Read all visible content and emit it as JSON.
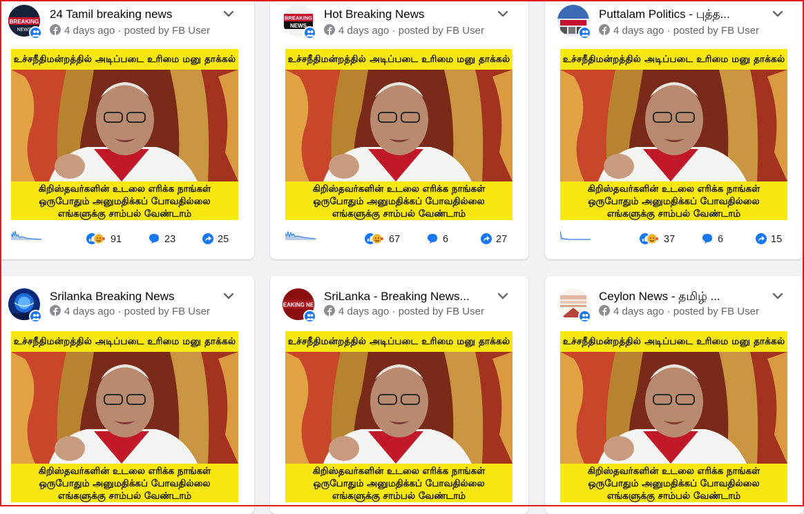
{
  "posts": [
    {
      "page_name": "24 Tamil breaking news",
      "time": "4 days ago",
      "posted_by": "posted by FB User",
      "reactions": "91",
      "comments": "23",
      "shares": "25",
      "avatar": "breaking-news-logo"
    },
    {
      "page_name": "Hot Breaking News",
      "time": "4 days ago",
      "posted_by": "posted by FB User",
      "reactions": "67",
      "comments": "6",
      "shares": "27",
      "avatar": "breaking-news-logo"
    },
    {
      "page_name": "Puttalam Politics - புத்த...",
      "time": "4 days ago",
      "posted_by": "posted by FB User",
      "reactions": "37",
      "comments": "6",
      "shares": "15",
      "avatar": "politics-logo"
    },
    {
      "page_name": "Srilanka Breaking News",
      "time": "4 days ago",
      "posted_by": "posted by FB User",
      "avatar": "globe-logo"
    },
    {
      "page_name": "SriLanka - Breaking News...",
      "time": "4 days ago",
      "posted_by": "posted by FB User",
      "avatar": "breaking-news-logo"
    },
    {
      "page_name": "Ceylon News - தமிழ் ...",
      "time": "4 days ago",
      "posted_by": "posted by FB User",
      "avatar": "ceylon-news-logo"
    }
  ],
  "post_image": {
    "headline": "உச்சநீதிமன்றத்தில் அடிப்படை உரிமை மனு தாக்கல்",
    "caption_line1": "கிறிஸ்தவர்களின் உடலை எரிக்க நாங்கள்",
    "caption_line2": "ஒருபோதும் அனுமதிக்கப் போவதில்லை",
    "caption_line3": "எங்களுக்கு சாம்பல் வேண்டாம்"
  },
  "colors": {
    "accent": "#1877f2",
    "card_bg": "#ffffff",
    "page_bg": "#f0f2f5",
    "post_yellow": "#f8e80f",
    "frame": "#e31b1b"
  }
}
